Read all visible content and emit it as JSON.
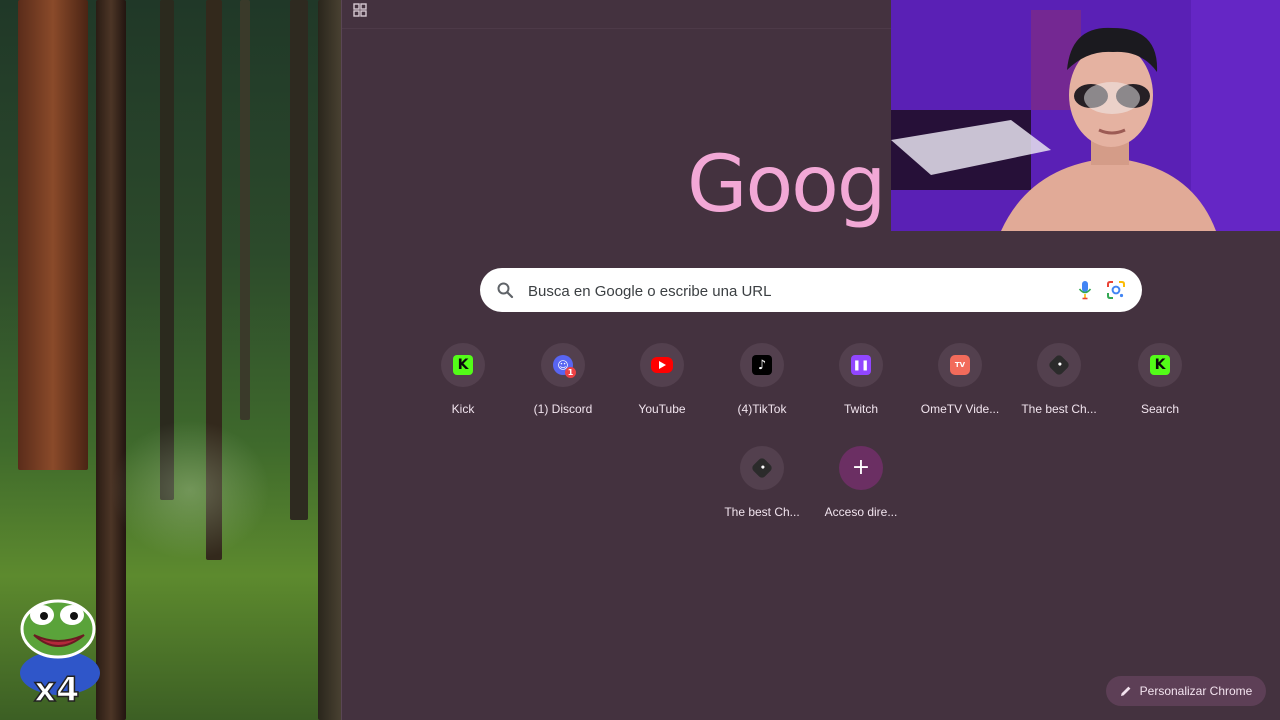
{
  "chrome": {
    "logo_text": "Googl",
    "search": {
      "placeholder": "Busca en Google o escribe una URL"
    },
    "shortcuts": [
      {
        "label": "Kick",
        "icon": "kick-icon",
        "color": "#53fc18"
      },
      {
        "label": "(1) Discord",
        "icon": "discord-icon",
        "color": "#5865f2"
      },
      {
        "label": "YouTube",
        "icon": "youtube-icon",
        "color": "#ff0000"
      },
      {
        "label": "(4)TikTok",
        "icon": "tiktok-icon",
        "color": "#000000"
      },
      {
        "label": "Twitch",
        "icon": "twitch-icon",
        "color": "#9146ff"
      },
      {
        "label": "OmeTV Vide...",
        "icon": "ometv-icon",
        "color": "#f26b5b"
      },
      {
        "label": "The best Ch...",
        "icon": "chat-dice-icon",
        "color": "#2b2b2b"
      },
      {
        "label": "Search",
        "icon": "kick-icon",
        "color": "#53fc18"
      },
      {
        "label": "The best Ch...",
        "icon": "chat-dice-icon",
        "color": "#2b2b2b"
      },
      {
        "label": "Acceso dire...",
        "icon": "add-shortcut-icon",
        "color": "#6b2f63"
      }
    ],
    "personalize_label": "Personalizar Chrome",
    "background_color": "#44323f",
    "logo_color": "#f2a8d6"
  },
  "overlay": {
    "badge_text": "x4"
  }
}
